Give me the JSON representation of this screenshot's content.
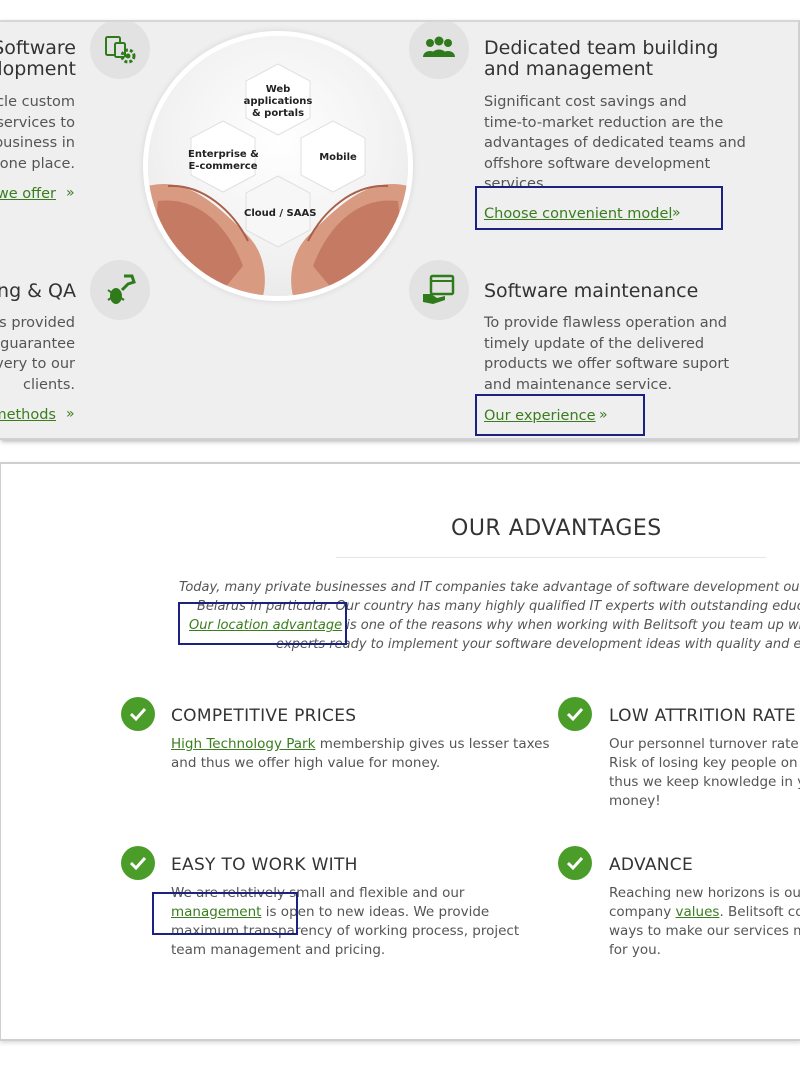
{
  "services": {
    "left_top": {
      "title_lines": [
        "Software",
        "development"
      ],
      "text_lines": [
        "Full cycle custom",
        "software services to",
        "grow your business in",
        "one place."
      ],
      "link": "What we offer"
    },
    "left_bottom": {
      "title": "Testing & QA",
      "text_lines": [
        "Software services provided",
        "by us guarantee",
        "quality delivery to our",
        "clients."
      ],
      "link": "Our methods"
    },
    "center": {
      "hex_web": [
        "Web",
        "applications",
        "& portals"
      ],
      "hex_enterprise": [
        "Enterprise &",
        "E-commerce"
      ],
      "hex_mobile": "Mobile",
      "hex_cloud": "Cloud / SAAS"
    },
    "right_top": {
      "title_lines": [
        "Dedicated team building",
        "and management"
      ],
      "text_lines": [
        "Significant cost savings and",
        "time-to-market reduction are the",
        "advantages of dedicated teams and",
        "offshore software development",
        "services."
      ],
      "link": "Choose convenient model",
      "chevron": "»"
    },
    "right_bottom": {
      "title": "Software maintenance",
      "text_lines": [
        "To provide flawless operation and",
        "timely update of the delivered",
        "products we offer software suport",
        "and maintenance service."
      ],
      "link": "Our experience",
      "chevron": "»"
    }
  },
  "advantages": {
    "title": "OUR ADVANTAGES",
    "intro": {
      "line1": "Today, many private businesses and IT companies take advantage of software development outsourcing",
      "line2": "Belarus in particular. Our country has many highly qualified IT experts with outstanding education a",
      "line3_link": "Our location advantage",
      "line3_rest": " is one of the reasons why when working with Belitsoft you team up with skilled",
      "line4": "experts ready to implement your software development ideas with quality and enthusia"
    },
    "items": [
      {
        "heading": "COMPETITIVE PRICES",
        "link": "High Technology Park",
        "line1_rest": " membership gives us lesser taxes",
        "line2": "and thus we offer high value for money."
      },
      {
        "heading": "LOW ATTRITION RATE",
        "lines": [
          "Our personnel turnover rate is",
          "Risk of losing key people on yo",
          "thus we keep knowledge in yo",
          "money!"
        ]
      },
      {
        "heading": "EASY TO WORK WITH",
        "line1": "We are relatively small and flexible and our",
        "link": "management",
        "line2_rest": " is open to new ideas. We provide",
        "line3": "maximum transparency of working process, project",
        "line4": "team management and pricing."
      },
      {
        "heading": "ADVANCE",
        "line1": "Reaching new horizons is our",
        "line2_pre": "company ",
        "link": "values",
        "line2_rest": ". Belitsoft cont",
        "line3": "ways to make our services mo",
        "line4": "for you."
      }
    ]
  },
  "colors": {
    "accent_green": "#4a9d28",
    "link_green": "#3a7d1e",
    "highlight_box": "#1c2280",
    "panel_bg": "#efefef"
  },
  "icons": [
    "devices-gear-icon",
    "team-icon",
    "bug-wrench-icon",
    "maintenance-screen-icon",
    "check-icon"
  ]
}
